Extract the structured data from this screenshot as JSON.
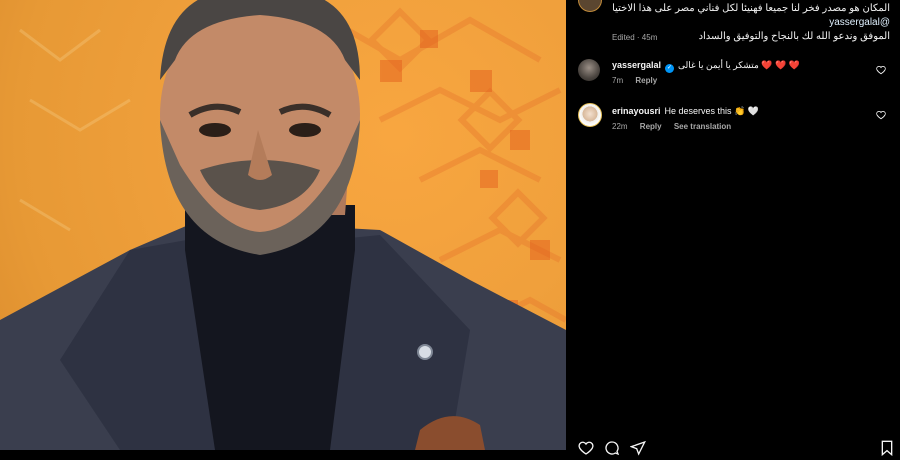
{
  "caption": {
    "line1": "المكان هو مصدر فخر لنا جميعا فهنيئا لكل فناني مصر على هذا الاختيار",
    "mention": "@yassergalal",
    "line3": "الموفق وندعو الله لك بالنجاح والتوفيق والسداد",
    "edited": "Edited · 45m"
  },
  "comments": [
    {
      "username": "yassergalal",
      "verified": true,
      "text": "متشكر يا أيمن يا غالى ❤️ ❤️ ❤️",
      "time": "7m",
      "reply_label": "Reply"
    },
    {
      "username": "erinayousri",
      "verified": false,
      "text": "He deserves this 👏 🤍",
      "time": "22m",
      "reply_label": "Reply",
      "translation_label": "See translation"
    }
  ],
  "icons": {
    "like": "heart-icon",
    "comment": "comment-icon",
    "share": "share-icon",
    "save": "bookmark-icon",
    "verified": "verified-badge-icon"
  },
  "colors": {
    "background_panel": "#000000",
    "media_background": "#f0a03c",
    "link": "#e0f1ff",
    "muted": "#a8a8a8",
    "verified": "#0095f6",
    "heart_red": "#ff3040"
  }
}
